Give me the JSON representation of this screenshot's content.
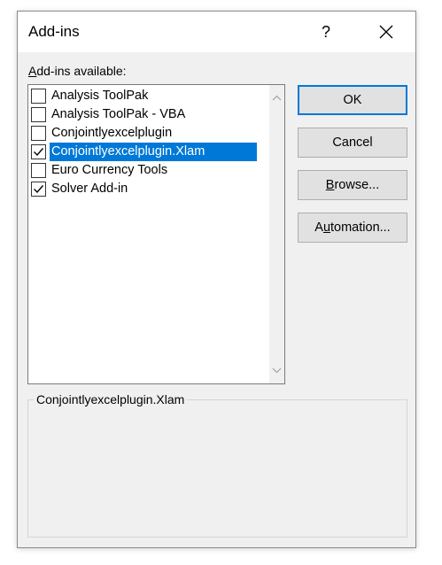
{
  "dialog": {
    "title": "Add-ins",
    "help_glyph": "?",
    "close_icon": "close-icon"
  },
  "list": {
    "label_accel": "A",
    "label_rest": "dd-ins available:",
    "items": [
      {
        "label": "Analysis ToolPak",
        "checked": false,
        "selected": false
      },
      {
        "label": "Analysis ToolPak - VBA",
        "checked": false,
        "selected": false
      },
      {
        "label": "Conjointlyexcelplugin",
        "checked": false,
        "selected": false
      },
      {
        "label": "Conjointlyexcelplugin.Xlam",
        "checked": true,
        "selected": true
      },
      {
        "label": "Euro Currency Tools",
        "checked": false,
        "selected": false
      },
      {
        "label": "Solver Add-in",
        "checked": true,
        "selected": false
      }
    ]
  },
  "buttons": {
    "ok": "OK",
    "cancel": "Cancel",
    "browse_accel": "B",
    "browse_rest": "rowse...",
    "automation_pre": "A",
    "automation_accel": "u",
    "automation_rest": "tomation..."
  },
  "description": {
    "title": "Conjointlyexcelplugin.Xlam"
  },
  "colors": {
    "selection": "#0078d7",
    "dialog_bg": "#f0f0f0"
  }
}
